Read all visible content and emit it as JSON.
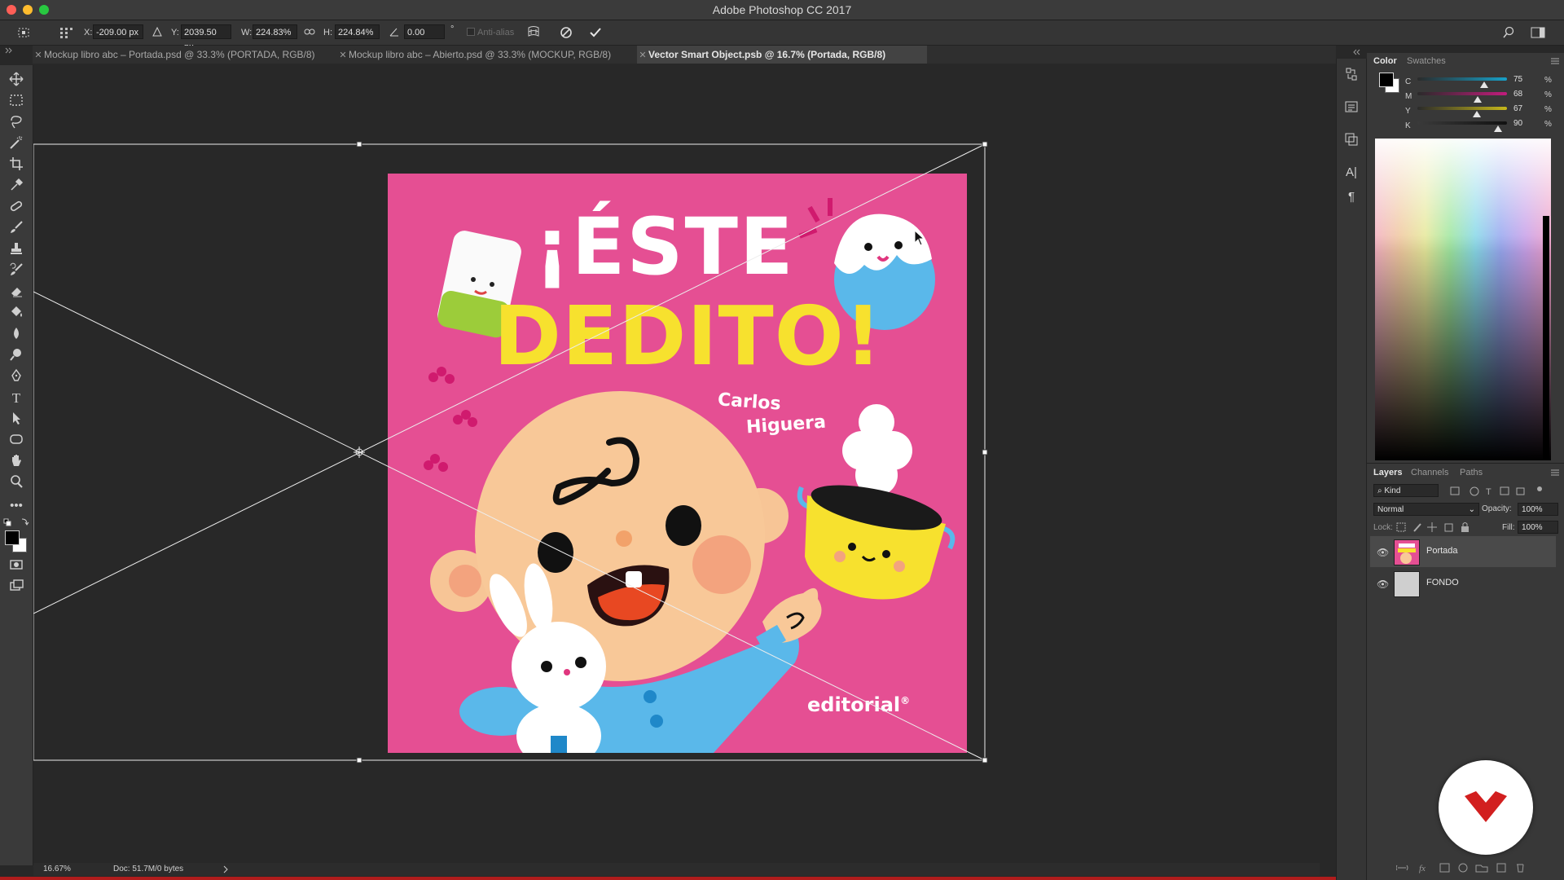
{
  "window": {
    "title": "Adobe Photoshop CC 2017",
    "traffic_colors": [
      "#ff5f57",
      "#febc2e",
      "#28c840"
    ]
  },
  "options_bar": {
    "x_label": "X:",
    "x_value": "-209.00 px",
    "y_label": "Y:",
    "y_value": "2039.50 px",
    "w_label": "W:",
    "w_value": "224.83%",
    "h_label": "H:",
    "h_value": "224.84%",
    "angle_value": "0.00",
    "angle_unit": "°",
    "antialias_label": "Anti-alias"
  },
  "tabs": [
    {
      "label": "Mockup libro abc – Portada.psd @ 33.3% (PORTADA, RGB/8)"
    },
    {
      "label": "Mockup libro abc – Abierto.psd @ 33.3% (MOCKUP, RGB/8)"
    },
    {
      "label": "Vector Smart Object.psb @ 16.7% (Portada, RGB/8)"
    }
  ],
  "artwork": {
    "line1": "¡ÉSTE",
    "line2": "DEDITO!",
    "author_first": "Carlos",
    "author_last": "Higuera",
    "publisher": "editorial",
    "publisher_mark": "®",
    "bg_color": "#e54f93",
    "title_yellow": "#f7e12e"
  },
  "status": {
    "zoom": "16.67%",
    "doc": "Doc: 51.7M/0 bytes"
  },
  "color_panel": {
    "tabs": [
      "Color",
      "Swatches"
    ],
    "channels": [
      {
        "label": "C",
        "value": "75",
        "level": 0.75,
        "color": "#17a0c8"
      },
      {
        "label": "M",
        "value": "68",
        "level": 0.68,
        "color": "#c21c7c"
      },
      {
        "label": "Y",
        "value": "67",
        "level": 0.67,
        "color": "#c7b81a"
      },
      {
        "label": "K",
        "value": "90",
        "level": 0.9,
        "color": "#5a5a5a"
      }
    ],
    "pct": "%"
  },
  "layers_panel": {
    "tabs": [
      "Layers",
      "Channels",
      "Paths"
    ],
    "kind_placeholder": "Kind",
    "blend_mode": "Normal",
    "opacity_label": "Opacity:",
    "opacity_value": "100%",
    "lock_label": "Lock:",
    "fill_label": "Fill:",
    "fill_value": "100%",
    "layers": [
      {
        "name": "Portada",
        "selected": true
      },
      {
        "name": "FONDO",
        "selected": false
      }
    ]
  }
}
